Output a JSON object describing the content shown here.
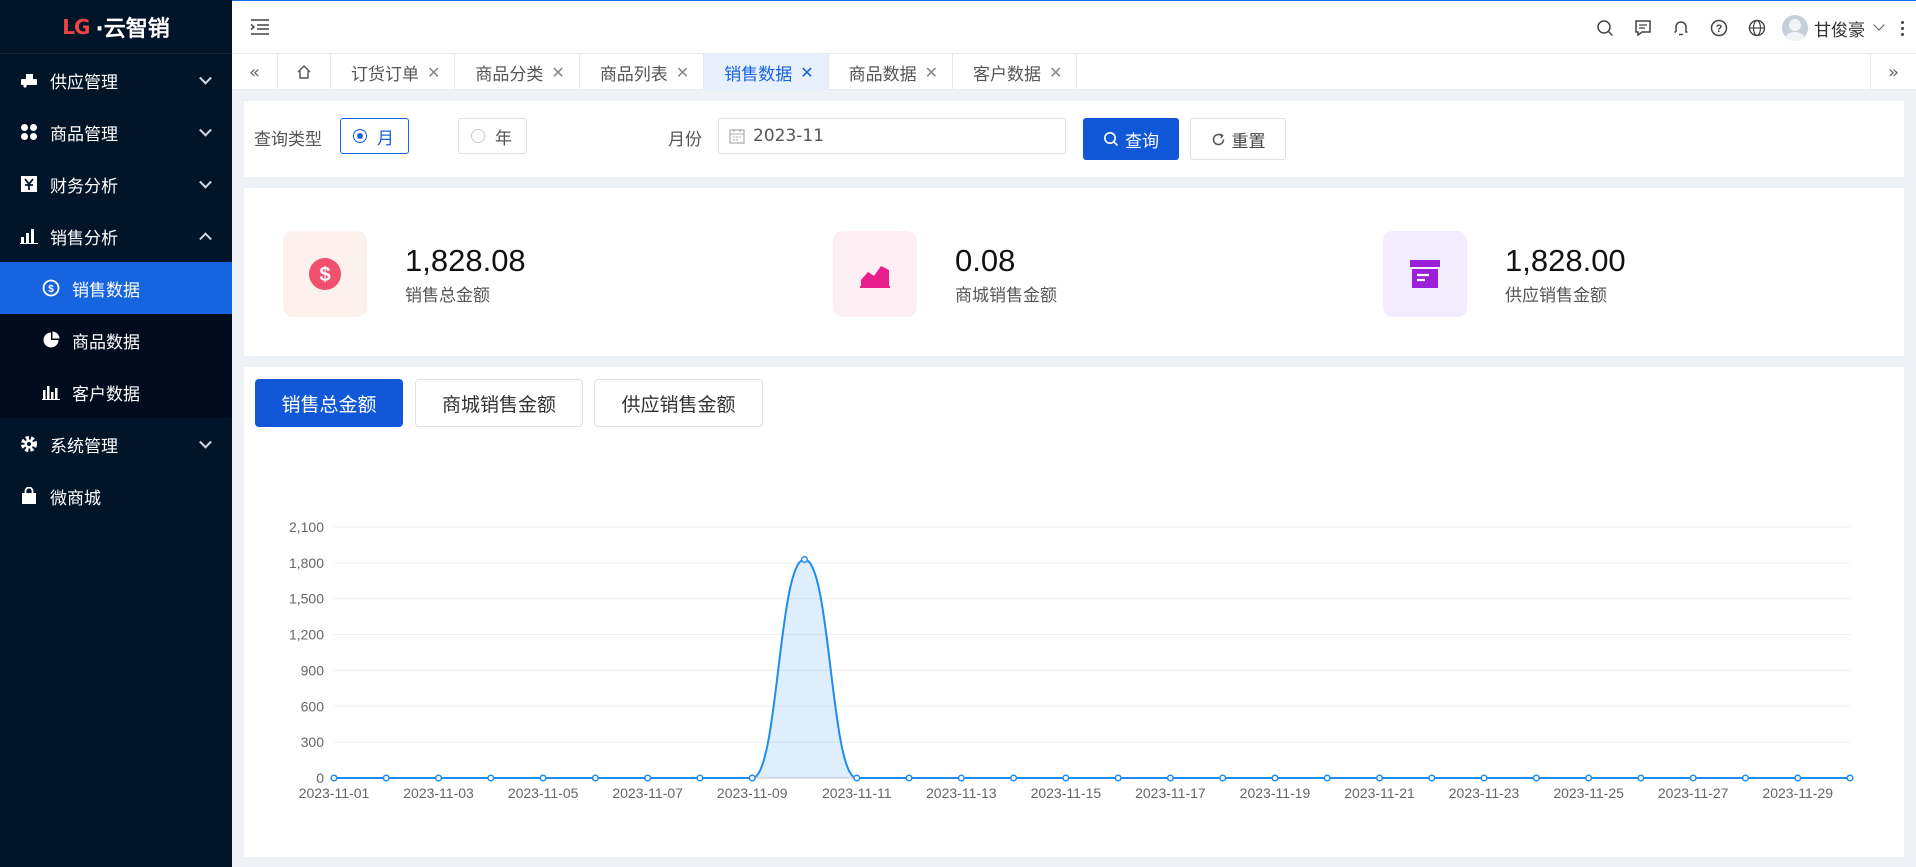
{
  "app": {
    "logo_mark": "LG",
    "logo_text": "·云智销"
  },
  "sidebar": {
    "items": [
      {
        "label": "供应管理",
        "icon": "truck-icon",
        "expanded": false
      },
      {
        "label": "商品管理",
        "icon": "grid-icon",
        "expanded": false
      },
      {
        "label": "财务分析",
        "icon": "finance-icon",
        "expanded": false
      },
      {
        "label": "销售分析",
        "icon": "bar-chart-icon",
        "expanded": true,
        "children": [
          {
            "label": "销售数据",
            "icon": "coin-icon",
            "active": true
          },
          {
            "label": "商品数据",
            "icon": "pie-icon",
            "active": false
          },
          {
            "label": "客户数据",
            "icon": "bars-icon",
            "active": false
          }
        ]
      },
      {
        "label": "系统管理",
        "icon": "gear-icon",
        "expanded": false
      },
      {
        "label": "微商城",
        "icon": "bag-icon",
        "expanded": false
      }
    ]
  },
  "header": {
    "user_name": "甘俊豪"
  },
  "tabs": [
    {
      "label": "订货订单",
      "active": false
    },
    {
      "label": "商品分类",
      "active": false
    },
    {
      "label": "商品列表",
      "active": false
    },
    {
      "label": "销售数据",
      "active": true
    },
    {
      "label": "商品数据",
      "active": false
    },
    {
      "label": "客户数据",
      "active": false
    }
  ],
  "query": {
    "type_label": "查询类型",
    "option_month": "月",
    "option_year": "年",
    "selected": "月",
    "month_label": "月份",
    "month_value": "2023-11",
    "search_label": "查询",
    "reset_label": "重置"
  },
  "stats": [
    {
      "value": "1,828.08",
      "label": "销售总金额",
      "color": "#f0506e",
      "bg": "#fdf1ee"
    },
    {
      "value": "0.08",
      "label": "商城销售金额",
      "color": "#e91e8c",
      "bg": "#fdeef4"
    },
    {
      "value": "1,828.00",
      "label": "供应销售金额",
      "color": "#9b1fd9",
      "bg": "#f3ecfc"
    }
  ],
  "chart_tabs": [
    {
      "label": "销售总金额",
      "active": true
    },
    {
      "label": "商城销售金额",
      "active": false
    },
    {
      "label": "供应销售金额",
      "active": false
    }
  ],
  "colors": {
    "accent": "#1664e0",
    "sidebar_bg": "#011428",
    "line": "#1f8cee"
  },
  "chart_data": {
    "type": "line",
    "smooth": true,
    "area": true,
    "x": [
      "2023-11-01",
      "2023-11-02",
      "2023-11-03",
      "2023-11-04",
      "2023-11-05",
      "2023-11-06",
      "2023-11-07",
      "2023-11-08",
      "2023-11-09",
      "2023-11-10",
      "2023-11-11",
      "2023-11-12",
      "2023-11-13",
      "2023-11-14",
      "2023-11-15",
      "2023-11-16",
      "2023-11-17",
      "2023-11-18",
      "2023-11-19",
      "2023-11-20",
      "2023-11-21",
      "2023-11-22",
      "2023-11-23",
      "2023-11-24",
      "2023-11-25",
      "2023-11-26",
      "2023-11-27",
      "2023-11-28",
      "2023-11-29",
      "2023-11-30"
    ],
    "x_tick_labels": [
      "2023-11-01",
      "2023-11-03",
      "2023-11-05",
      "2023-11-07",
      "2023-11-09",
      "2023-11-11",
      "2023-11-13",
      "2023-11-15",
      "2023-11-17",
      "2023-11-19",
      "2023-11-21",
      "2023-11-23",
      "2023-11-25",
      "2023-11-27",
      "2023-11-29"
    ],
    "values": [
      0,
      0,
      0,
      0,
      0,
      0,
      0,
      0,
      0,
      1828.08,
      0,
      0,
      0,
      0,
      0,
      0,
      0,
      0,
      0,
      0,
      0,
      0,
      0,
      0,
      0,
      0,
      0,
      0,
      0,
      0
    ],
    "yticks": [
      0,
      300,
      600,
      900,
      1200,
      1500,
      1800,
      2100
    ],
    "ylim": [
      0,
      2100
    ],
    "grid": true,
    "legend": "none"
  }
}
